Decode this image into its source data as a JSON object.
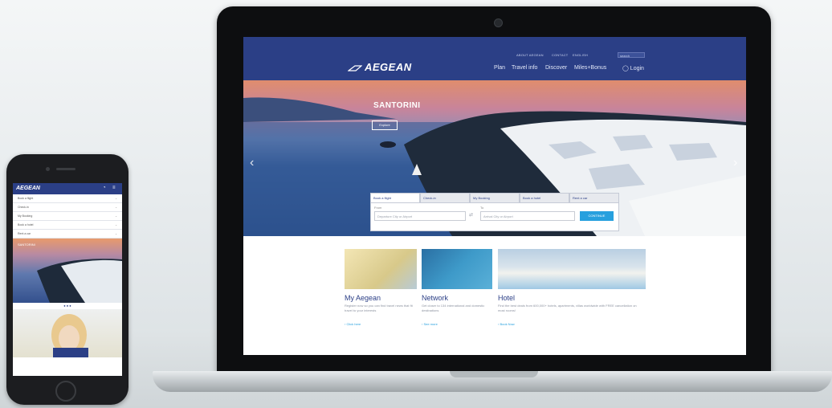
{
  "laptop_site": {
    "brand": "AEGEAN",
    "utility_links": [
      "ABOUT AEGEAN",
      "CONTACT",
      "ENGLISH"
    ],
    "search_placeholder": "search",
    "nav": [
      "Plan",
      "Travel info",
      "Discover",
      "Miles+Bonus",
      "Login"
    ],
    "hero": {
      "title": "SANTORINI",
      "button": "Explore"
    },
    "booking": {
      "tabs": [
        "Book a flight",
        "Check-in",
        "My Booking",
        "Book a hotel",
        "Rent a car"
      ],
      "from_label": "From",
      "to_label": "To",
      "from_placeholder": "Departure City or Airport",
      "to_placeholder": "Arrival City or Airport",
      "continue": "CONTINUE"
    },
    "cards": [
      {
        "title": "My Aegean",
        "text": "Register now so you can find travel news that fit travel to your interests",
        "link": "Click here"
      },
      {
        "title": "Network",
        "text": "Get closer to 134 international and domestic destinations",
        "link": "See more"
      },
      {
        "title": "Hotel",
        "text": "Find the best deals from 600,000+ hotels, apartments, villas worldwide with FREE cancellation on most rooms!",
        "link": "Book Now"
      }
    ]
  },
  "phone_site": {
    "brand": "AEGEAN",
    "menu": [
      "Book a flight",
      "Check-in",
      "My Booking",
      "Book a hotel",
      "Rent a car"
    ],
    "hero_title": "SANTORINI",
    "dots": "● ● ●"
  },
  "colors": {
    "brand_blue": "#2b3f86",
    "accent": "#27a0de"
  }
}
